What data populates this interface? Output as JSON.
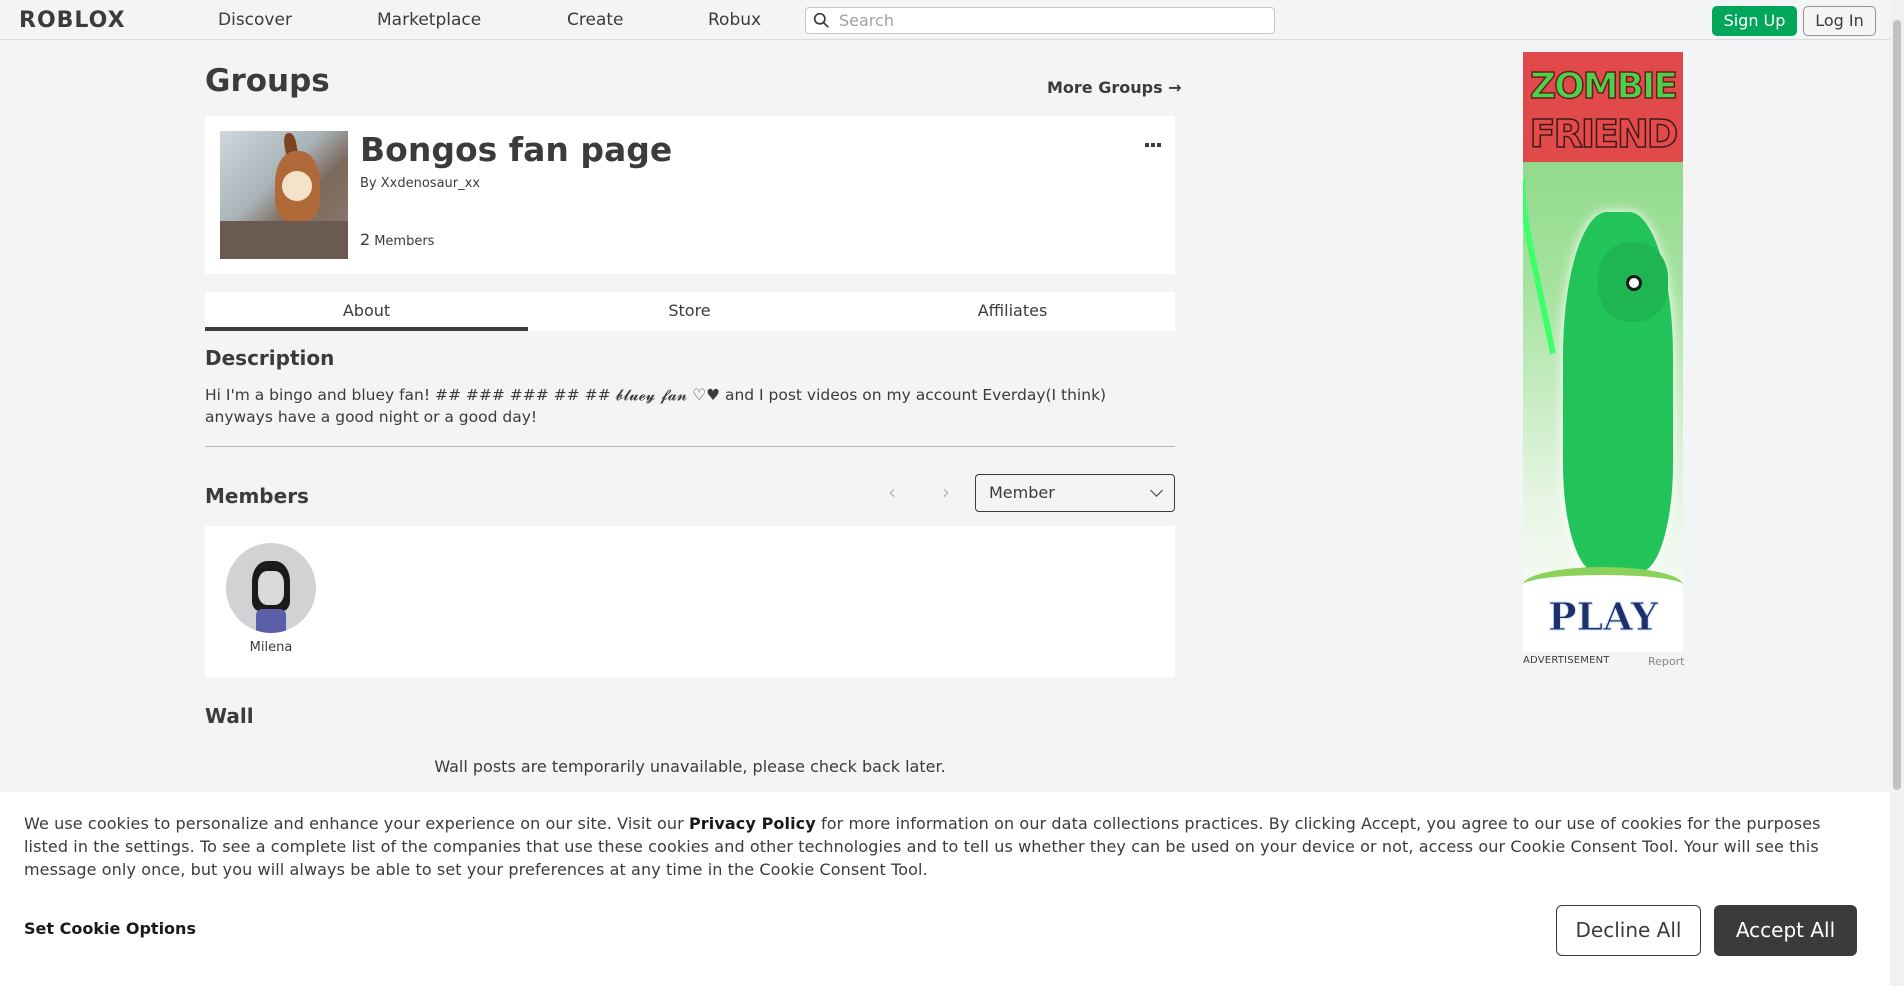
{
  "nav": {
    "logo": "ROBLOX",
    "links": [
      "Discover",
      "Marketplace",
      "Create",
      "Robux"
    ],
    "search_placeholder": "Search",
    "signup_label": "Sign Up",
    "login_label": "Log In"
  },
  "page": {
    "title": "Groups",
    "more_groups": "More Groups →"
  },
  "group": {
    "name": "Bongos fan page",
    "by_label": "By",
    "owner": "Xxdenosaur_xx",
    "member_count": "2",
    "members_label": "Members"
  },
  "tabs": [
    {
      "label": "About",
      "active": true
    },
    {
      "label": "Store",
      "active": false
    },
    {
      "label": "Affiliates",
      "active": false
    }
  ],
  "description": {
    "heading": "Description",
    "text": "Hi I'm a bingo and bluey fan! ## ### ### ## ## 𝓫𝓵𝓾𝓮𝔂 𝓯𝓪𝓷 ♡♥ and I post videos on my account Everday(I think) anyways have a good night or a good day!"
  },
  "members": {
    "heading": "Members",
    "role_selected": "Member",
    "list": [
      {
        "name": "Milena"
      }
    ]
  },
  "wall": {
    "heading": "Wall",
    "message": "Wall posts are temporarily unavailable, please check back later."
  },
  "ad": {
    "title_line1": "ZOMBIE",
    "title_line2": "FRIEND",
    "cta": "PLAY",
    "label": "ADVERTISEMENT",
    "report": "Report"
  },
  "cookie": {
    "text_before": "We use cookies to personalize and enhance your experience on our site. Visit our ",
    "link": "Privacy Policy",
    "text_after": " for more information on our data collections practices. By clicking Accept, you agree to our use of cookies for the purposes listed in the settings. To see a complete list of the companies that use these cookies and other technologies and to tell us whether they can be used on your device or not, access our Cookie Consent Tool. Your will see this message only once, but you will always be able to set your preferences at any time in the Cookie Consent Tool.",
    "options_label": "Set Cookie Options",
    "decline_label": "Decline All",
    "accept_label": "Accept All"
  }
}
